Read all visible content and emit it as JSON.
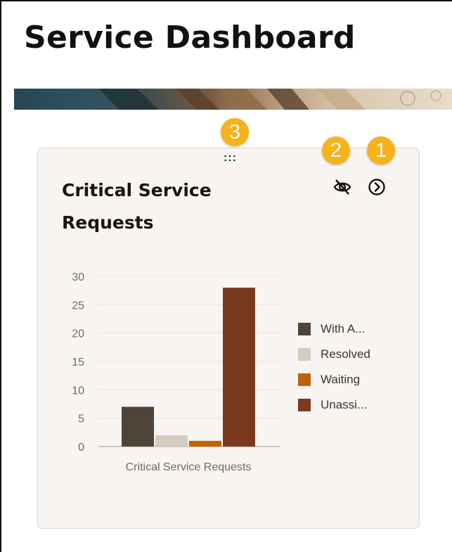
{
  "header": {
    "title": "Service Dashboard"
  },
  "badges": {
    "one": "1",
    "two": "2",
    "three": "3"
  },
  "card": {
    "title": "Critical Service Requests",
    "drag_handle": ":::",
    "actions": [
      {
        "name": "hide",
        "icon": "eye-slash-icon"
      },
      {
        "name": "open",
        "icon": "chevron-right-circle-icon"
      }
    ]
  },
  "chart_data": {
    "type": "bar",
    "categories": [
      "Critical Service Requests"
    ],
    "series": [
      {
        "name": "With A...",
        "values": [
          7
        ],
        "color": "#4e4439"
      },
      {
        "name": "Resolved",
        "values": [
          2
        ],
        "color": "#d6cbbf"
      },
      {
        "name": "Waiting",
        "values": [
          1
        ],
        "color": "#bf6202"
      },
      {
        "name": "Unassi...",
        "values": [
          28
        ],
        "color": "#7b3a1f"
      }
    ],
    "xlabel": "",
    "ylabel": "",
    "ylim": [
      0,
      30
    ],
    "yticks": [
      0,
      5,
      10,
      15,
      20,
      25,
      30
    ],
    "legend": "right",
    "grid": true
  },
  "colors": {
    "badge": "#f7b21a",
    "card_bg": "#f7f4f1"
  }
}
